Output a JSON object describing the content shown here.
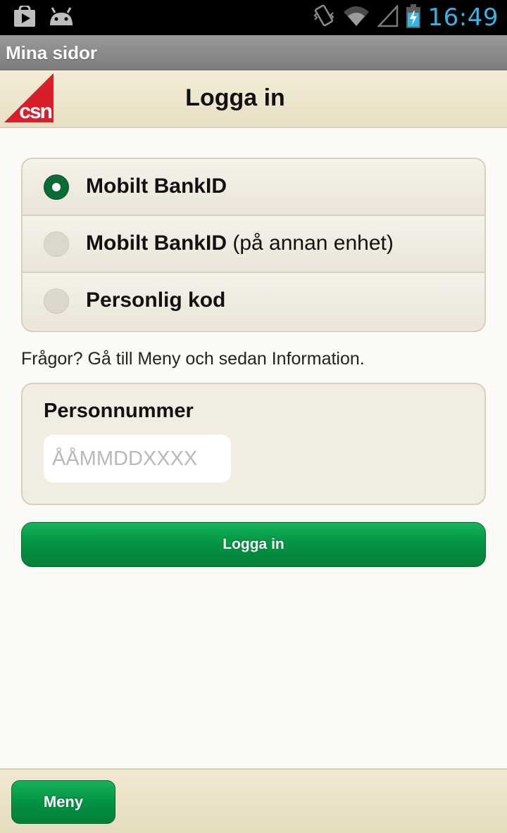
{
  "status_bar": {
    "time": "16:49",
    "icons": [
      "play-store-icon",
      "android-icon",
      "vibrate-icon",
      "wifi-icon",
      "signal-icon",
      "battery-charging-icon"
    ]
  },
  "app_bar": {
    "title": "Mina sidor"
  },
  "header": {
    "title": "Logga in",
    "logo_text": "csn"
  },
  "login_methods": [
    {
      "bold": "Mobilt BankID",
      "normal": "",
      "selected": true
    },
    {
      "bold": "Mobilt BankID",
      "normal": " (på annan enhet)",
      "selected": false
    },
    {
      "bold": "Personlig kod",
      "normal": "",
      "selected": false
    }
  ],
  "info_text": "Frågor? Gå till Meny och sedan Information.",
  "personnummer": {
    "label": "Personnummer",
    "placeholder": "ÅÅMMDDXXXX",
    "value": ""
  },
  "login_button": "Logga in",
  "footer": {
    "menu_button": "Meny"
  },
  "colors": {
    "accent_green": "#039243",
    "logo_red": "#d81e2a",
    "status_time": "#33b5e5"
  }
}
